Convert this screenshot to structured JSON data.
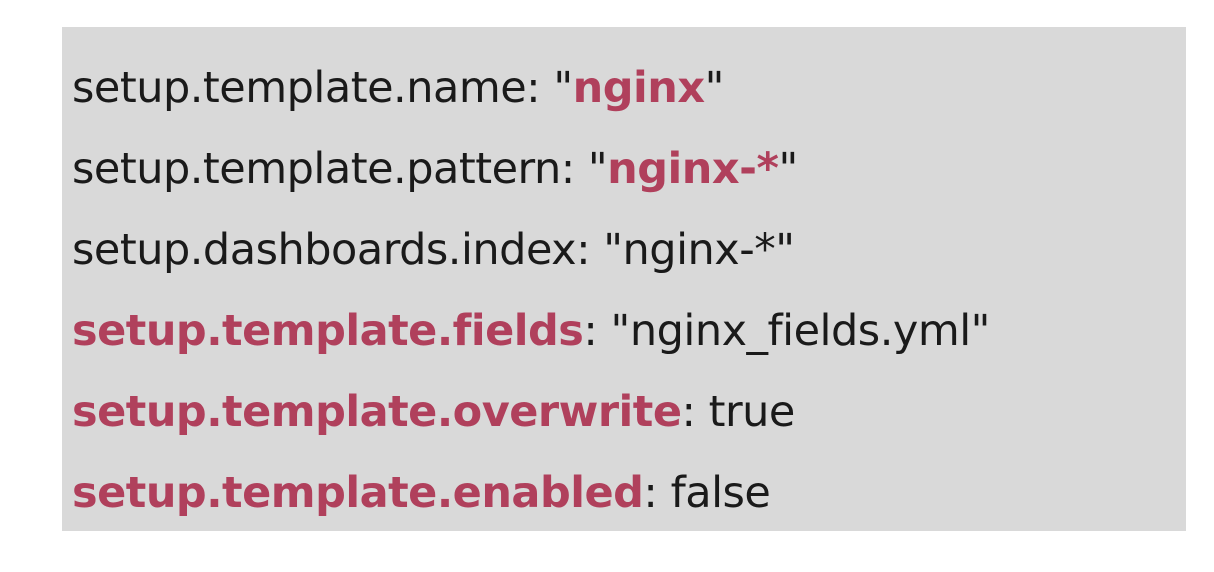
{
  "colors": {
    "background": "#ffffff",
    "block_background": "#d9d9d9",
    "text": "#1a1a1a",
    "highlight": "#b0405c"
  },
  "lines": [
    {
      "p1": "setup.template.name: \"",
      "h1": "",
      "p2": "",
      "h2": "nginx",
      "p3": "\""
    },
    {
      "p1": "setup.template.pattern: \"",
      "h1": "",
      "p2": "",
      "h2": "nginx-*",
      "p3": "\""
    },
    {
      "p1": "setup.dashboards.index: \"nginx-*\"",
      "h1": "",
      "p2": "",
      "h2": "",
      "p3": ""
    },
    {
      "p1": "",
      "h1": "setup.template.fields",
      "p2": ": \"nginx_fields.yml\"",
      "h2": "",
      "p3": ""
    },
    {
      "p1": "",
      "h1": "setup.template.overwrite",
      "p2": ": true",
      "h2": "",
      "p3": ""
    },
    {
      "p1": "",
      "h1": "setup.template.enabled",
      "p2": ": false",
      "h2": "",
      "p3": ""
    }
  ]
}
